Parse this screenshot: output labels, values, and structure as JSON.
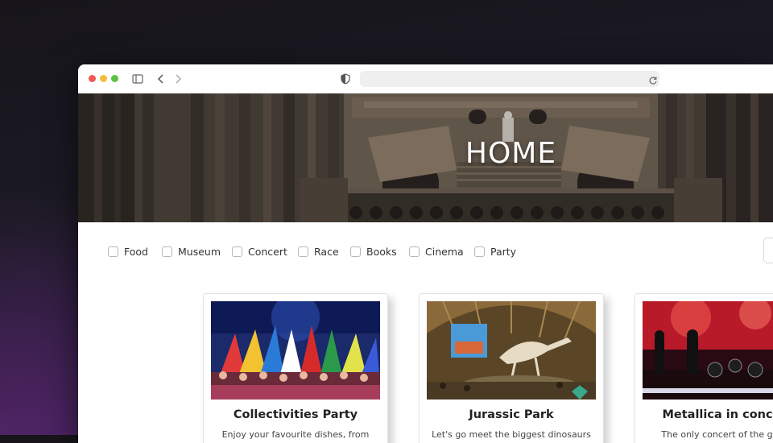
{
  "hero": {
    "title": "HOME"
  },
  "filters": [
    {
      "label": "Food"
    },
    {
      "label": "Museum"
    },
    {
      "label": "Concert"
    },
    {
      "label": "Race"
    },
    {
      "label": "Books"
    },
    {
      "label": "Cinema"
    },
    {
      "label": "Party"
    }
  ],
  "cards": [
    {
      "title": "Collectivities Party",
      "description": "Enjoy your favourite dishes, from"
    },
    {
      "title": "Jurassic Park",
      "description": "Let's go meet the biggest dinosaurs"
    },
    {
      "title": "Metallica in concert",
      "description": "The only concert of the group"
    }
  ],
  "colors": {
    "traffic_red": "#ee5a52",
    "traffic_yellow": "#f4bd3e",
    "traffic_green": "#5bc244"
  },
  "icons": {
    "sidebar": "sidebar-icon",
    "back": "chevron-left-icon",
    "forward": "chevron-right-icon",
    "privacy": "shield-icon",
    "reload": "reload-icon"
  }
}
